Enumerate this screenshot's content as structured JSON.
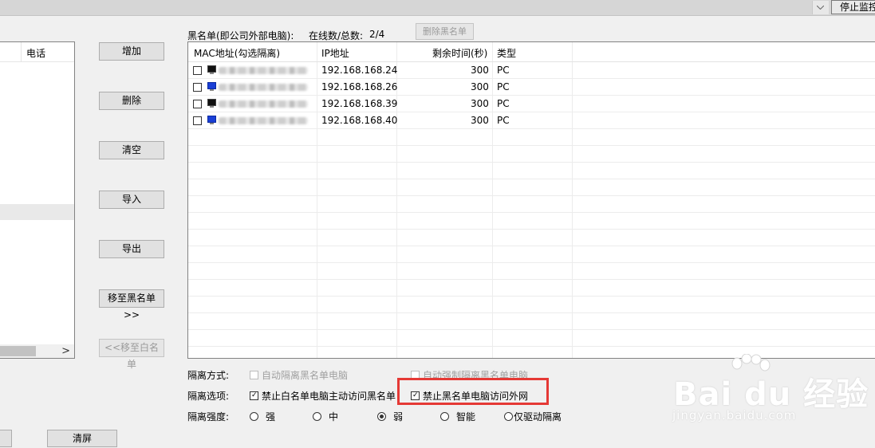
{
  "topbar": {
    "stop_button": "停止监控"
  },
  "whitelist": {
    "col_phone": "电话"
  },
  "middle_buttons": {
    "add": "增加",
    "delete": "删除",
    "clear": "清空",
    "import": "导入",
    "export": "导出",
    "move_to_black": "移至黑名单>>",
    "move_to_white": "<<移至白名单"
  },
  "blacklist": {
    "title": "黑名单(即公司外部电脑):",
    "online_label": "在线数/总数:",
    "online_value": "2/4",
    "delete_button": "删除黑名单",
    "columns": {
      "mac": "MAC地址(勾选隔离)",
      "ip": "IP地址",
      "remaining": "剩余时间(秒)",
      "type": "类型"
    },
    "rows": [
      {
        "mac": "",
        "ip": "192.168.168.24",
        "remaining": "300",
        "type": "PC",
        "icon": "monitor-dark",
        "checked": false
      },
      {
        "mac": "",
        "ip": "192.168.168.26",
        "remaining": "300",
        "type": "PC",
        "icon": "monitor-blue",
        "checked": false
      },
      {
        "mac": "",
        "ip": "192.168.168.39",
        "remaining": "300",
        "type": "PC",
        "icon": "monitor-dark",
        "checked": false
      },
      {
        "mac": "",
        "ip": "192.168.168.40",
        "remaining": "300",
        "type": "PC",
        "icon": "monitor-blue",
        "checked": false
      }
    ]
  },
  "options": {
    "method_label": "隔离方式:",
    "method_auto_isolate": "自动隔离黑名单电脑",
    "method_force_isolate": "自动强制隔离黑名单电脑",
    "select_label": "隔离选项:",
    "select_ban_white": "禁止白名单电脑主动访问黑名单",
    "select_ban_black": "禁止黑名单电脑访问外网",
    "strength_label": "隔离强度:",
    "strength_options": [
      "强",
      "中",
      "弱",
      "智能",
      "仅驱动隔离"
    ],
    "strength_selected": "弱"
  },
  "bottom": {
    "clear_screen": "清屏"
  },
  "watermark": {
    "logo": "Bai du 经验",
    "url": "jingyan.baidu.com"
  },
  "colors": {
    "highlight": "#e53935",
    "window_bg": "#f0f0f0"
  }
}
